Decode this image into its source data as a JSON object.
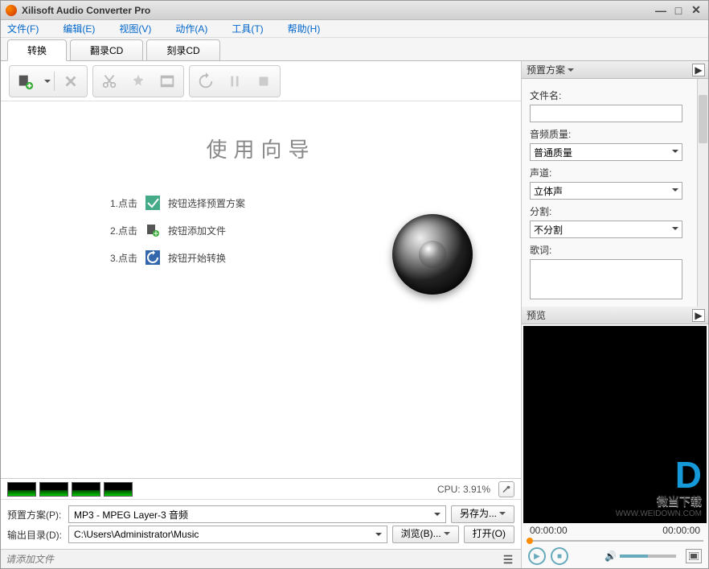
{
  "app": {
    "title": "Xilisoft Audio Converter Pro"
  },
  "menu": {
    "file": "文件(F)",
    "edit": "编辑(E)",
    "view": "视图(V)",
    "action": "动作(A)",
    "tools": "工具(T)",
    "help": "帮助(H)"
  },
  "tabs": {
    "convert": "转换",
    "ripcd": "翻录CD",
    "burncd": "刻录CD"
  },
  "wizard": {
    "title": "使用向导",
    "step1_num": "1.点击",
    "step1_text": "按钮选择预置方案",
    "step2_num": "2.点击",
    "step2_text": "按钮添加文件",
    "step3_num": "3.点击",
    "step3_text": "按钮开始转换"
  },
  "cpu": {
    "label": "CPU: 3.91%"
  },
  "settings": {
    "preset_label": "预置方案(P):",
    "preset_value": "MP3 - MPEG Layer-3 音频",
    "saveas": "另存为...",
    "outdir_label": "输出目录(D):",
    "outdir_value": "C:\\Users\\Administrator\\Music",
    "browse": "浏览(B)...",
    "open": "打开(O)"
  },
  "search": {
    "placeholder": "请添加文件"
  },
  "rightpanel": {
    "preset_header": "预置方案",
    "filename_label": "文件名:",
    "filename_value": "",
    "quality_label": "音频质量:",
    "quality_value": "普通质量",
    "channel_label": "声道:",
    "channel_value": "立体声",
    "split_label": "分割:",
    "split_value": "不分割",
    "lyrics_label": "歌词:",
    "lyrics_value": "",
    "preview_header": "预览",
    "time_left": "00:00:00",
    "time_right": "00:00:00"
  },
  "watermark": {
    "brand": "微当下载",
    "url": "WWW.WEIDOWN.COM"
  }
}
